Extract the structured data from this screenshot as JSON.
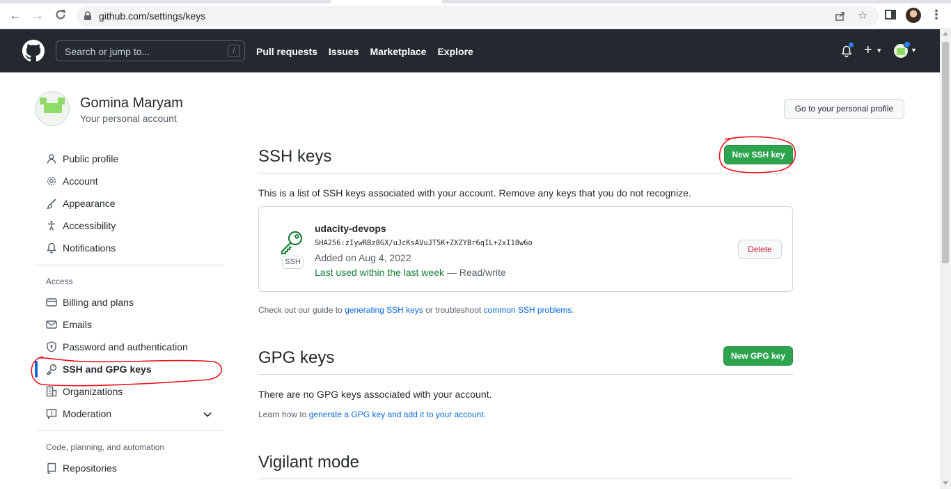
{
  "browser": {
    "url": "github.com/settings/keys",
    "icons": [
      "back-arrow-icon",
      "forward-arrow-icon",
      "reload-icon",
      "lock-icon",
      "share-icon",
      "star-icon",
      "side-panel-icon",
      "profile-icon",
      "kebab-menu-icon"
    ]
  },
  "header": {
    "search_placeholder": "Search or jump to...",
    "search_shortcut": "/",
    "nav": [
      "Pull requests",
      "Issues",
      "Marketplace",
      "Explore"
    ]
  },
  "account": {
    "name": "Gomina Maryam",
    "subtitle": "Your personal account",
    "profile_button": "Go to your personal profile"
  },
  "sidebar": {
    "items": [
      {
        "label": "Public profile",
        "icon": "person-icon"
      },
      {
        "label": "Account",
        "icon": "gear-icon"
      },
      {
        "label": "Appearance",
        "icon": "paintbrush-icon"
      },
      {
        "label": "Accessibility",
        "icon": "accessibility-icon"
      },
      {
        "label": "Notifications",
        "icon": "bell-icon"
      }
    ],
    "access_heading": "Access",
    "access_items": [
      {
        "label": "Billing and plans",
        "icon": "credit-card-icon"
      },
      {
        "label": "Emails",
        "icon": "mail-icon"
      },
      {
        "label": "Password and authentication",
        "icon": "shield-lock-icon"
      },
      {
        "label": "SSH and GPG keys",
        "icon": "key-icon",
        "selected": true
      },
      {
        "label": "Organizations",
        "icon": "organization-icon"
      },
      {
        "label": "Moderation",
        "icon": "report-icon"
      }
    ],
    "code_heading": "Code, planning, and automation",
    "code_items": [
      {
        "label": "Repositories",
        "icon": "repo-icon"
      }
    ]
  },
  "ssh": {
    "title": "SSH keys",
    "new_button": "New SSH key",
    "description": "This is a list of SSH keys associated with your account. Remove any keys that you do not recognize.",
    "key": {
      "type_label": "SSH",
      "title": "udacity-devops",
      "fingerprint": "SHA256:zIywRBz8GX/uJcKsAVuJT5K+ZXZYBr6qIL+2xI18w6o",
      "added": "Added on Aug 4, 2022",
      "last_used": "Last used within the last week",
      "access": " — Read/write",
      "delete_button": "Delete"
    },
    "guide_prefix": "Check out our guide to ",
    "guide_link1": "generating SSH keys",
    "guide_mid": " or troubleshoot ",
    "guide_link2": "common SSH problems",
    "guide_suffix": "."
  },
  "gpg": {
    "title": "GPG keys",
    "new_button": "New GPG key",
    "empty_text": "There are no GPG keys associated with your account.",
    "learn_prefix": "Learn how to ",
    "learn_link": "generate a GPG key and add it to your account",
    "learn_suffix": "."
  },
  "vigilant": {
    "title": "Vigilant mode"
  },
  "colors": {
    "header_bg": "#24292f",
    "green_button": "#2da44e",
    "link": "#0969da",
    "selected_bar": "#0969da",
    "annotation_red": "#e8141c"
  }
}
